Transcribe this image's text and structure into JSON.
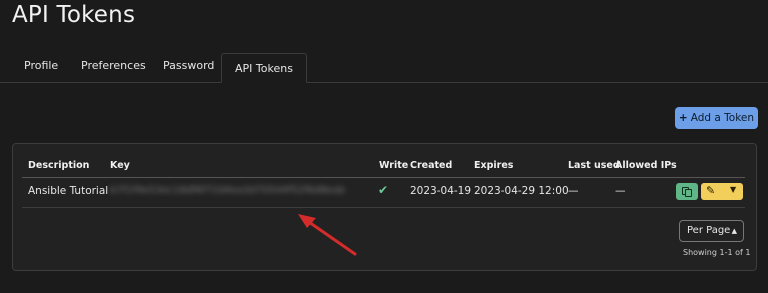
{
  "page": {
    "title": "API Tokens"
  },
  "tabs": [
    {
      "label": "Profile"
    },
    {
      "label": "Preferences"
    },
    {
      "label": "Password"
    },
    {
      "label": "API Tokens",
      "active": true
    }
  ],
  "toolbar": {
    "add_button_label": "Add a Token",
    "add_icon": "plus-icon"
  },
  "table": {
    "columns": [
      "Description",
      "Key",
      "Write",
      "Created",
      "Expires",
      "Last used",
      "Allowed IPs"
    ],
    "rows": [
      {
        "description": "Ansible Tutorial",
        "key": "b7f1f9e53ec18df6f72d4ea3d70544f52f6d8eab",
        "write": "check-icon",
        "created": "2023-04-19",
        "expires": "2023-04-29 12:00",
        "last_used": "—",
        "allowed_ips": "—",
        "actions": [
          "copy-icon",
          "pencil-icon",
          "caret-down-icon"
        ]
      }
    ]
  },
  "pagination": {
    "per_page_label": "Per Page",
    "showing_text": "Showing 1-1 of 1"
  },
  "annotation": {
    "arrow_color": "#d42b2b"
  },
  "colors": {
    "background": "#1b1b1b",
    "card": "#222222",
    "primary": "#6c9fe8",
    "success": "#5fb686",
    "warning": "#f2cf5b"
  }
}
